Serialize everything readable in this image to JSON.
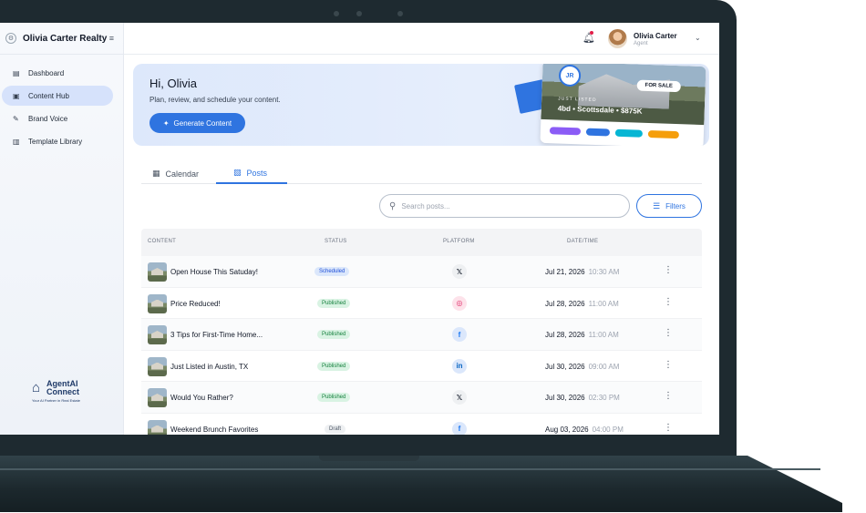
{
  "sidebar": {
    "brand": "Olivia Carter Realty",
    "items": [
      {
        "label": "Dashboard",
        "icon": "dashboard-icon"
      },
      {
        "label": "Content Hub",
        "icon": "content-hub-icon"
      },
      {
        "label": "Brand Voice",
        "icon": "brand-voice-icon"
      },
      {
        "label": "Template Library",
        "icon": "template-library-icon"
      }
    ],
    "logo": {
      "line1": "AgentAI",
      "line2": "Connect",
      "tagline": "Your AI Partner in Real Estate"
    }
  },
  "header": {
    "user_name": "Olivia Carter",
    "user_role": "Agent"
  },
  "hero": {
    "greeting": "Hi, Olivia",
    "subtitle": "Plan, review, and schedule your content.",
    "button_label": "Generate Content",
    "preview": {
      "initials": "JR",
      "badge": "FOR SALE",
      "tag": "JUST LISTED",
      "listing": "4bd • Scottsdale • $875K"
    }
  },
  "tabs": [
    {
      "label": "Calendar"
    },
    {
      "label": "Posts"
    }
  ],
  "search": {
    "placeholder": "Search posts..."
  },
  "filters_label": "Filters",
  "table": {
    "columns": [
      "CONTENT",
      "STATUS",
      "PLATFORM",
      "DATE/TIME"
    ],
    "rows": [
      {
        "title": "Open House This Satuday!",
        "status": "Scheduled",
        "platform": "X",
        "date": "Jul 21, 2026",
        "time": "10:30 AM"
      },
      {
        "title": "Price Reduced!",
        "status": "Published",
        "platform": "Instagram",
        "date": "Jul 28, 2026",
        "time": "11:00 AM"
      },
      {
        "title": "3 Tips for First-Time Home...",
        "status": "Published",
        "platform": "Facebook",
        "date": "Jul 28, 2026",
        "time": "11:00 AM"
      },
      {
        "title": "Just Listed in Austin, TX",
        "status": "Published",
        "platform": "LinkedIn",
        "date": "Jul 30, 2026",
        "time": "09:00 AM"
      },
      {
        "title": "Would You Rather?",
        "status": "Published",
        "platform": "X",
        "date": "Jul 30, 2026",
        "time": "02:30 PM"
      },
      {
        "title": "Weekend Brunch Favorites",
        "status": "Draft",
        "platform": "Facebook",
        "date": "Aug 03, 2026",
        "time": "04:00 PM"
      }
    ]
  },
  "colors": {
    "accent": "#2f74e0",
    "frame": "#1e2a30"
  }
}
